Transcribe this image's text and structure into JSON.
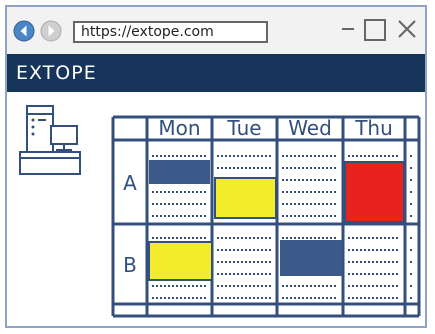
{
  "browser": {
    "url": "https://extope.com",
    "back_icon": "back-arrow-icon",
    "forward_icon": "forward-arrow-icon",
    "minimize_icon": "minimize-icon",
    "maximize_icon": "maximize-icon",
    "close_icon": "close-icon"
  },
  "app": {
    "brand": "EXTOPE",
    "brand_color": "#17345b"
  },
  "schedule": {
    "days": [
      "Mon",
      "Tue",
      "Wed",
      "Thu"
    ],
    "rows": [
      "A",
      "B"
    ],
    "blocks": [
      {
        "row": "A",
        "day": "Mon",
        "color": "#3b5a8a"
      },
      {
        "row": "A",
        "day": "Tue",
        "color": "#f2ec2c"
      },
      {
        "row": "A",
        "day": "Thu",
        "color": "#e8231f"
      },
      {
        "row": "B",
        "day": "Mon",
        "color": "#f2ec2c"
      },
      {
        "row": "B",
        "day": "Wed",
        "color": "#3b5a8a"
      }
    ],
    "grid_color": "#33507d"
  }
}
